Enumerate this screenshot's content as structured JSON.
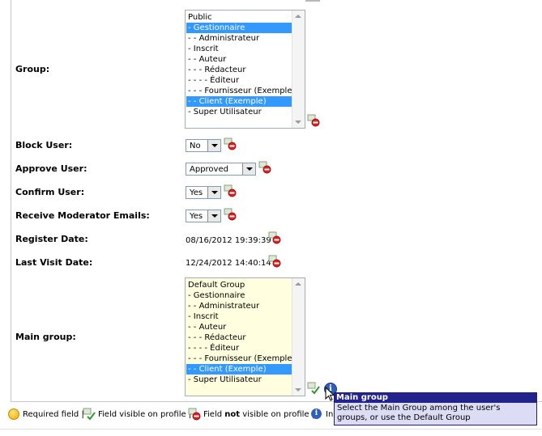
{
  "form": {
    "group": {
      "label": "Group:",
      "options": [
        {
          "text": "Public",
          "selected": false
        },
        {
          "text": "- Gestionnaire",
          "selected": true
        },
        {
          "text": "- - Administrateur",
          "selected": false
        },
        {
          "text": "- Inscrit",
          "selected": false
        },
        {
          "text": "- - Auteur",
          "selected": false
        },
        {
          "text": "- - - Rédacteur",
          "selected": false
        },
        {
          "text": "- - - - Éditeur",
          "selected": false
        },
        {
          "text": "- - - Fournisseur (Exemple)",
          "selected": false
        },
        {
          "text": "- - Client (Exemple)",
          "selected": true
        },
        {
          "text": "- Super Utilisateur",
          "selected": false
        }
      ]
    },
    "block_user": {
      "label": "Block User:",
      "value": "No"
    },
    "approve_user": {
      "label": "Approve User:",
      "value": "Approved"
    },
    "confirm_user": {
      "label": "Confirm User:",
      "value": "Yes"
    },
    "receive_moderator_emails": {
      "label": "Receive Moderator Emails:",
      "value": "Yes"
    },
    "register_date": {
      "label": "Register Date:",
      "value": "08/16/2012 19:39:39"
    },
    "last_visit_date": {
      "label": "Last Visit Date:",
      "value": "12/24/2012 14:40:14"
    },
    "main_group": {
      "label": "Main group:",
      "options": [
        {
          "text": "Default Group",
          "selected": false
        },
        {
          "text": "- Gestionnaire",
          "selected": false
        },
        {
          "text": "- - Administrateur",
          "selected": false
        },
        {
          "text": "- Inscrit",
          "selected": false
        },
        {
          "text": "- - Auteur",
          "selected": false
        },
        {
          "text": "- - - Rédacteur",
          "selected": false
        },
        {
          "text": "- - - - Éditeur",
          "selected": false
        },
        {
          "text": "- - - Fournisseur (Exemple)",
          "selected": false
        },
        {
          "text": "- - Client (Exemple)",
          "selected": true
        },
        {
          "text": "- Super Utilisateur",
          "selected": false
        }
      ]
    }
  },
  "tooltip": {
    "title": "Main group",
    "body_line1": "Select the Main Group among the user's",
    "body_line2": "groups, or use the Default Group"
  },
  "legend": {
    "required": "Required field |",
    "visible": "Field visible on profile |",
    "not_visible_pre": "Field ",
    "not_visible_bold": "not",
    "not_visible_post": " visible on profile |",
    "info_partial": "In"
  },
  "colors": {
    "selection": "#3399ff",
    "main_group_bg": "#ffffe0",
    "tooltip_title_bg": "#23238e",
    "tooltip_bg": "#dcdcf5"
  },
  "icons": {
    "visibility_hidden": "profile-hidden-icon",
    "visibility_visible": "profile-visible-icon",
    "info": "info-icon",
    "required": "required-field-icon",
    "cursor": "mouse-pointer-icon"
  }
}
